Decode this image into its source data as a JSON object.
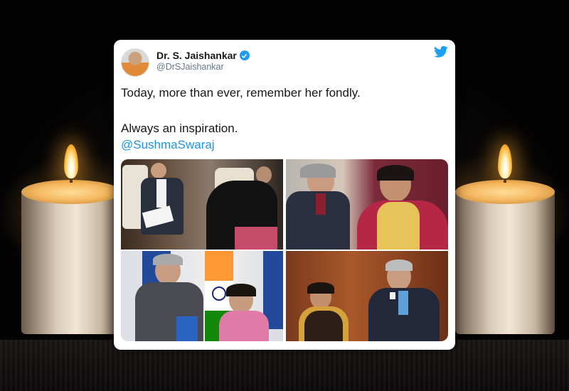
{
  "tweet": {
    "author_name": "Dr. S. Jaishankar",
    "handle": "@DrSJaishankar",
    "line1": "Today, more than ever, remember her fondly.",
    "line2": "Always an inspiration.",
    "mention": "@SushmaSwaraj",
    "verified": true,
    "brand_icon": "twitter-bird-icon",
    "colors": {
      "accent": "#1b95e0",
      "text": "#14171a",
      "subtle": "#657786"
    }
  },
  "photos": [
    {
      "name": "photo-aircraft"
    },
    {
      "name": "photo-greeting"
    },
    {
      "name": "photo-flags"
    },
    {
      "name": "photo-office"
    }
  ],
  "scene": {
    "icons": [
      "candle-icon",
      "candle-icon"
    ]
  }
}
